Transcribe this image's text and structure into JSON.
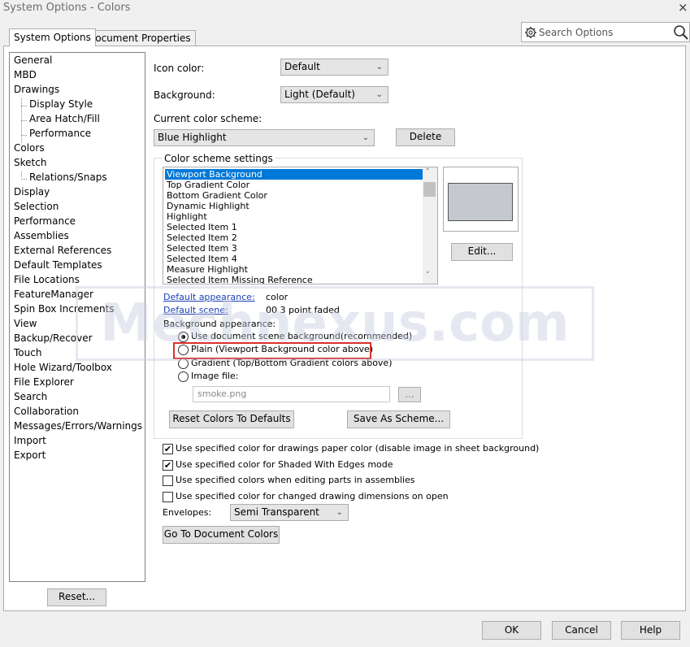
{
  "window": {
    "title": "System Options - Colors",
    "close_icon": "×"
  },
  "tabs": [
    {
      "label": "System Options"
    },
    {
      "label": "Document Properties"
    }
  ],
  "search": {
    "placeholder": "Search Options"
  },
  "tree": {
    "items": [
      {
        "label": "General",
        "child": false
      },
      {
        "label": "MBD",
        "child": false
      },
      {
        "label": "Drawings",
        "child": false
      },
      {
        "label": "Display Style",
        "child": true
      },
      {
        "label": "Area Hatch/Fill",
        "child": true
      },
      {
        "label": "Performance",
        "child": true
      },
      {
        "label": "Colors",
        "child": false
      },
      {
        "label": "Sketch",
        "child": false
      },
      {
        "label": "Relations/Snaps",
        "child": true
      },
      {
        "label": "Display",
        "child": false
      },
      {
        "label": "Selection",
        "child": false
      },
      {
        "label": "Performance",
        "child": false
      },
      {
        "label": "Assemblies",
        "child": false
      },
      {
        "label": "External References",
        "child": false
      },
      {
        "label": "Default Templates",
        "child": false
      },
      {
        "label": "File Locations",
        "child": false
      },
      {
        "label": "FeatureManager",
        "child": false
      },
      {
        "label": "Spin Box Increments",
        "child": false
      },
      {
        "label": "View",
        "child": false
      },
      {
        "label": "Backup/Recover",
        "child": false
      },
      {
        "label": "Touch",
        "child": false
      },
      {
        "label": "Hole Wizard/Toolbox",
        "child": false
      },
      {
        "label": "File Explorer",
        "child": false
      },
      {
        "label": "Search",
        "child": false
      },
      {
        "label": "Collaboration",
        "child": false
      },
      {
        "label": "Messages/Errors/Warnings",
        "child": false
      },
      {
        "label": "Import",
        "child": false
      },
      {
        "label": "Export",
        "child": false
      }
    ],
    "reset_label": "Reset..."
  },
  "main": {
    "icon_color": {
      "label": "Icon color:",
      "value": "Default"
    },
    "background": {
      "label": "Background:",
      "value": "Light (Default)"
    },
    "scheme": {
      "label": "Current color scheme:",
      "value": "Blue Highlight",
      "delete_label": "Delete"
    },
    "settings_group": {
      "title": "Color scheme settings",
      "items": [
        "Viewport Background",
        "Top Gradient Color",
        "Bottom Gradient Color",
        "Dynamic Highlight",
        "Highlight",
        "Selected Item 1",
        "Selected Item 2",
        "Selected Item 3",
        "Selected Item 4",
        "Measure Highlight",
        "Selected Item Missing Reference"
      ],
      "selected_index": 0,
      "edit_label": "Edit...",
      "swatch_color": "#c6c8d0",
      "default_appearance_link": "Default appearance:",
      "default_appearance_value": "color",
      "default_scene_link": "Default scene:",
      "default_scene_value": "00 3 point faded",
      "bg_appearance_label": "Background appearance:",
      "radios": [
        {
          "label": "Use document scene background(recommended)",
          "checked": true
        },
        {
          "label": "Plain (Viewport Background color above)",
          "checked": false
        },
        {
          "label": "Gradient (Top/Bottom Gradient colors above)",
          "checked": false
        },
        {
          "label": "Image file:",
          "checked": false
        }
      ],
      "image_file_value": "smoke.png",
      "browse_label": "...",
      "reset_colors_label": "Reset Colors To Defaults",
      "save_scheme_label": "Save As Scheme..."
    },
    "checkboxes": [
      {
        "label": "Use specified color for drawings paper color (disable image in sheet background)",
        "checked": true
      },
      {
        "label": "Use specified color for Shaded With Edges mode",
        "checked": true
      },
      {
        "label": "Use specified colors when editing parts in assemblies",
        "checked": false
      },
      {
        "label": "Use specified color for changed drawing dimensions on open",
        "checked": false
      }
    ],
    "envelopes": {
      "label": "Envelopes:",
      "value": "Semi Transparent"
    },
    "go_to_doc_colors_label": "Go To Document Colors"
  },
  "watermark": "Mechnexus.com",
  "footer": {
    "ok": "OK",
    "cancel": "Cancel",
    "help": "Help"
  },
  "colors": {
    "selection": "#0078d7",
    "highlight_box": "#d9302c",
    "link": "#1a3fb5"
  }
}
